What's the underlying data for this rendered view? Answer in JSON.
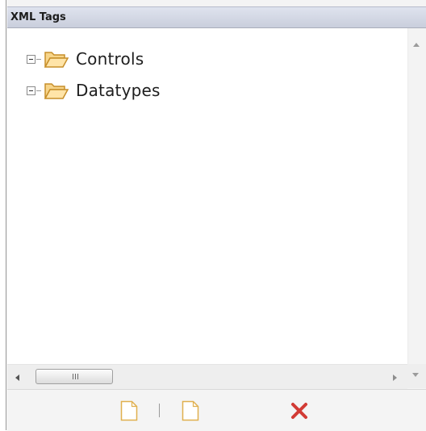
{
  "panel": {
    "title": "XML Tags",
    "tree": [
      {
        "label": "Controls",
        "expanded": true,
        "icon": "open-folder-icon"
      },
      {
        "label": "Datatypes",
        "expanded": true,
        "icon": "open-folder-icon"
      }
    ],
    "scroll_grip": "III",
    "toolbar": [
      {
        "name": "new-document",
        "icon": "document-icon"
      },
      {
        "name": "new-document-2",
        "icon": "document-icon"
      },
      {
        "name": "delete",
        "icon": "red-x-icon"
      }
    ]
  },
  "colors": {
    "header_top": "#dfe3ee",
    "header_bottom": "#c9cedc",
    "folder": "#f5c96d",
    "delete": "#d23b35"
  }
}
